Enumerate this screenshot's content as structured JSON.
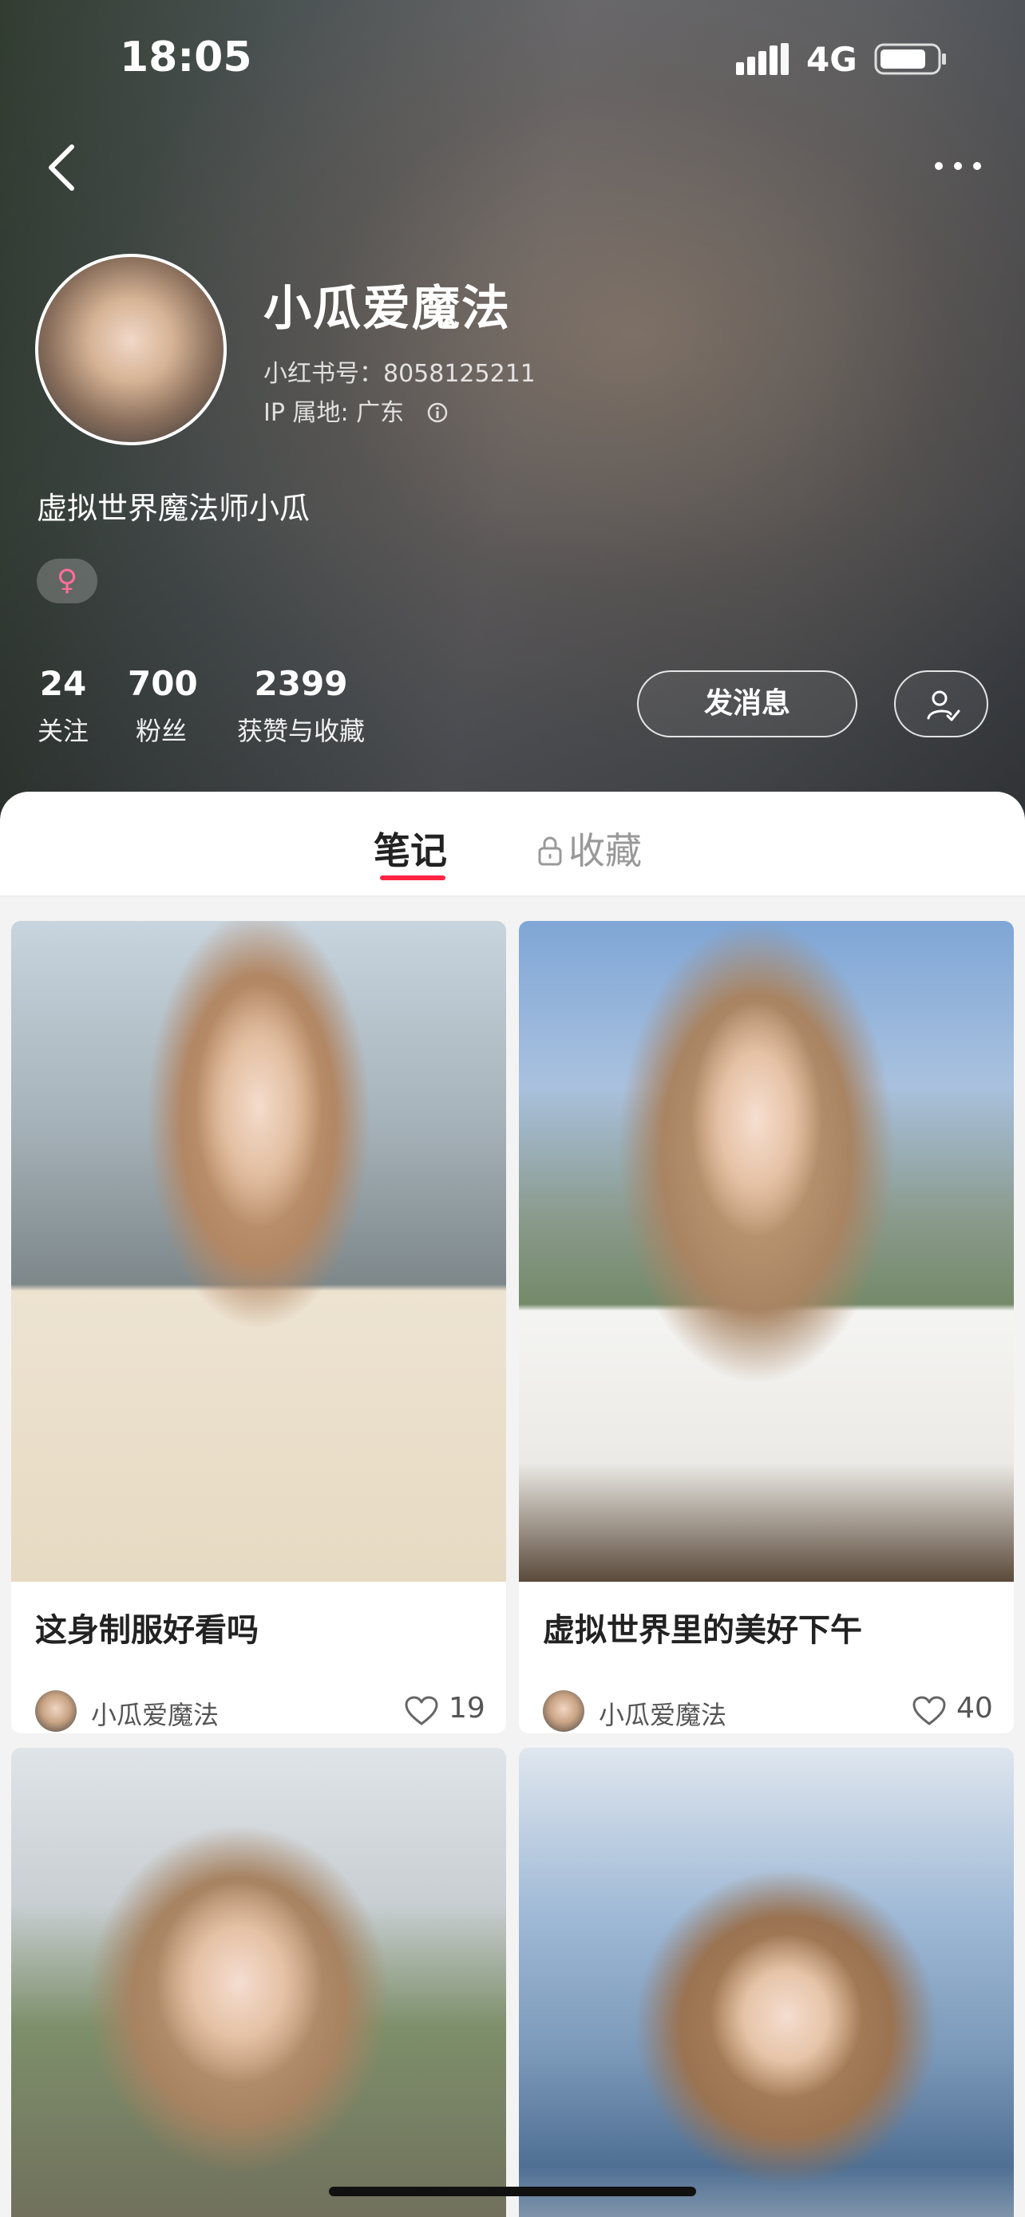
{
  "status_bar": {
    "time": "18:05",
    "network": "4G",
    "icons": [
      "signal-icon",
      "battery-icon"
    ]
  },
  "nav": {
    "back_icon": "chevron-left-icon",
    "more_icon": "more-dots-icon"
  },
  "profile": {
    "nickname": "小瓜爱魔法",
    "account_id": "小红书号：8058125211",
    "ip_location": "IP 属地: 广东",
    "bio": "虚拟世界魔法师小瓜",
    "gender_symbol": "♀",
    "gender_color": "#ff6d9a",
    "stats": [
      {
        "value": "24",
        "label": "关注"
      },
      {
        "value": "700",
        "label": "粉丝"
      },
      {
        "value": "2399",
        "label": "获赞与收藏"
      }
    ],
    "message_button": "发消息",
    "follow_icon": "user-check-icon"
  },
  "tabs": {
    "notes": "笔记",
    "collections": "收藏",
    "accent_color": "#ff2442"
  },
  "feed": {
    "cards": [
      {
        "title": "这身制服好看吗",
        "author": "小瓜爱魔法",
        "likes": "19"
      },
      {
        "title": "虚拟世界里的美好下午",
        "author": "小瓜爱魔法",
        "likes": "40"
      },
      {
        "title": "",
        "author": "",
        "likes": ""
      },
      {
        "title": "",
        "author": "",
        "likes": ""
      }
    ]
  }
}
